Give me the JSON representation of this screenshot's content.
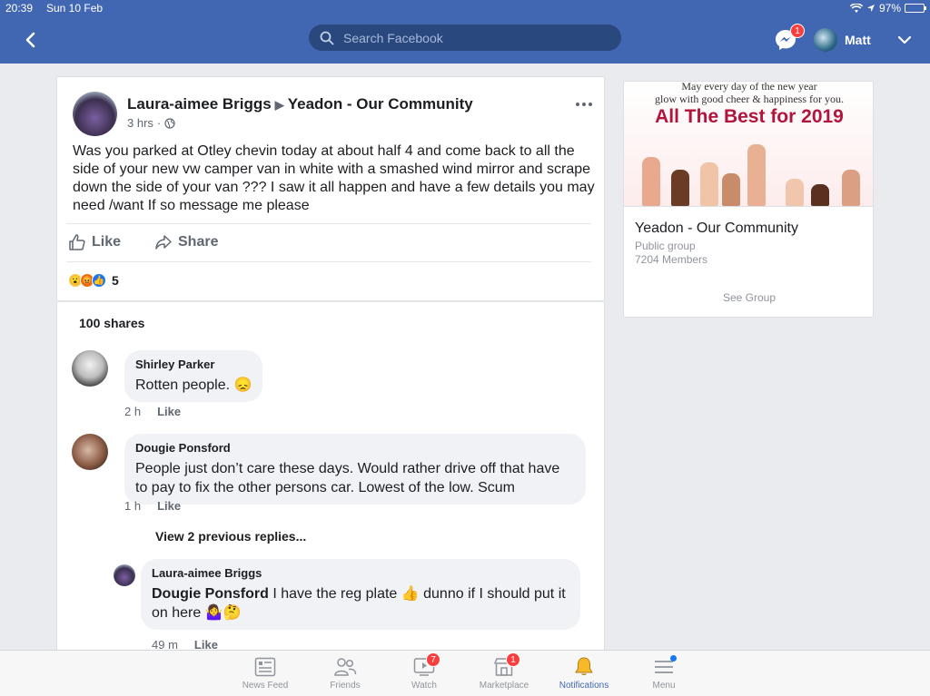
{
  "status_bar": {
    "time": "20:39",
    "date": "Sun 10 Feb",
    "battery": "97%",
    "battery_level": 0.97
  },
  "header": {
    "search_placeholder": "Search Facebook",
    "messenger_badge": "1",
    "profile_name": "Matt"
  },
  "post": {
    "author": "Laura-aimee Briggs",
    "group": "Yeadon - Our Community",
    "time": "3 hrs",
    "text": "Was you parked at Otley chevin today at about half 4 and come back to all the side of your new vw camper van in white with a smashed wind mirror and scrape down the side of your van ??? I saw it all happen and have a few details you may need /want If so message me please",
    "like_label": "Like",
    "share_label": "Share",
    "reaction_count": "5",
    "shares_label": "100 shares"
  },
  "comments": [
    {
      "name": "Shirley Parker",
      "text": "Rotten people. 😞",
      "time": "2 h",
      "like": "Like"
    },
    {
      "name": "Dougie Ponsford",
      "text": "People just don’t care these days. Would rather drive off that have to pay to fix the other persons car. Lowest of the low. Scum",
      "time": "1 h",
      "like": "Like"
    }
  ],
  "view_replies": "View 2 previous replies...",
  "reply": {
    "name": "Laura-aimee Briggs",
    "mention": "Dougie Ponsford",
    "text": " I have the reg plate 👍 dunno if I should put it on here 🤷‍♀️🤔",
    "time": "49 m",
    "like": "Like"
  },
  "group_card": {
    "banner_line1": "May every day of the new year",
    "banner_line2": "glow with good cheer & happiness for you.",
    "banner_title": "All The Best for 2019",
    "name": "Yeadon - Our Community",
    "type": "Public group",
    "members": "7204 Members",
    "see_group": "See Group"
  },
  "tabs": [
    {
      "label": "News Feed"
    },
    {
      "label": "Friends"
    },
    {
      "label": "Watch",
      "badge": "7"
    },
    {
      "label": "Marketplace",
      "badge": "1"
    },
    {
      "label": "Notifications"
    },
    {
      "label": "Menu"
    }
  ],
  "colors": {
    "brand": "#4267b2",
    "active_tab": "#4267b2",
    "badge": "#fa3e3e"
  }
}
